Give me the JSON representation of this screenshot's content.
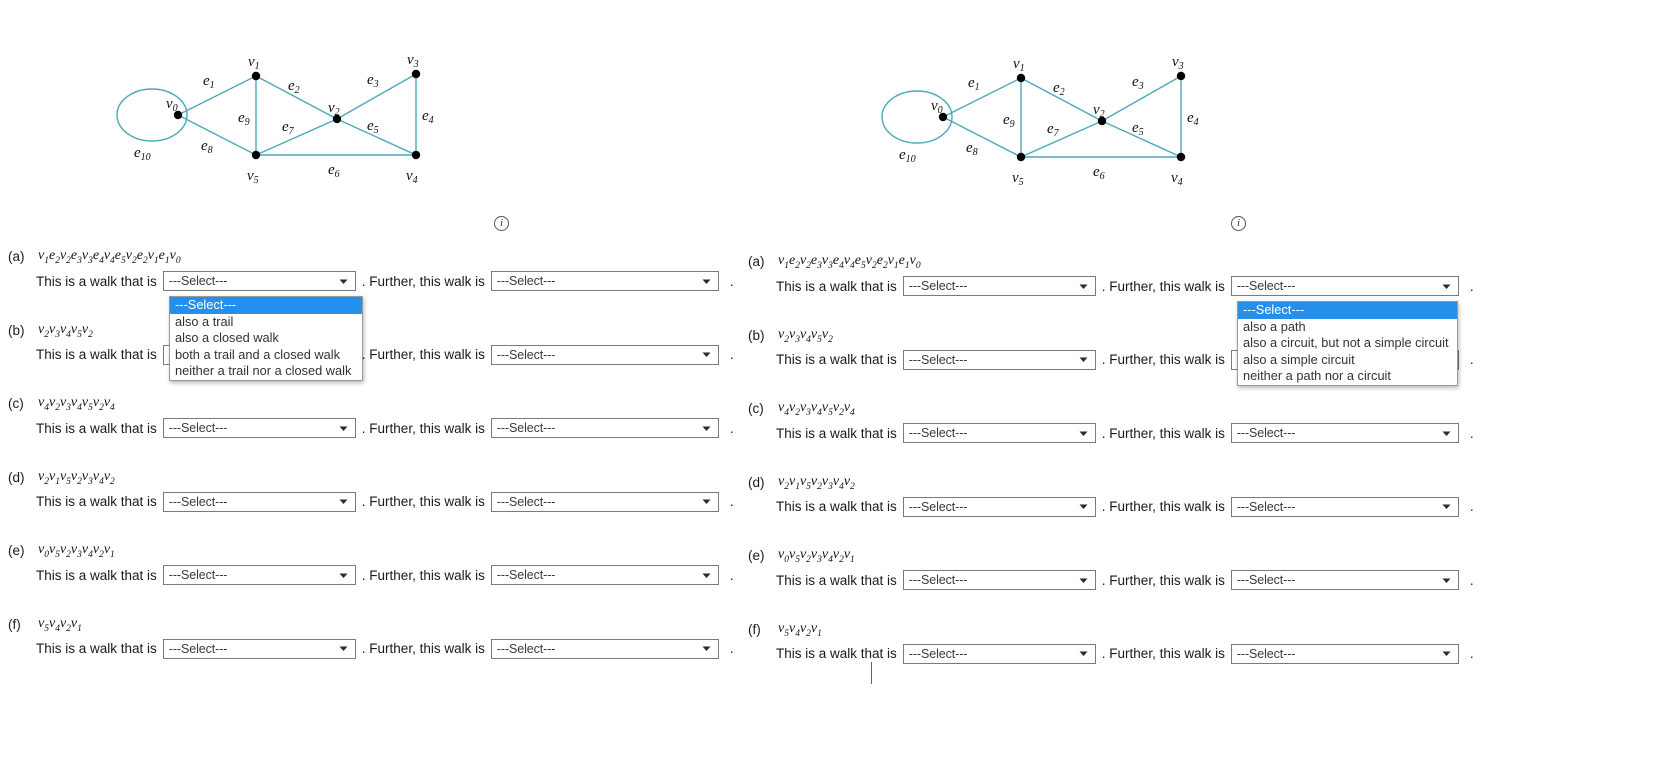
{
  "graph": {
    "caption_icon": "info-icon",
    "vertices": [
      {
        "id": "v0",
        "label": "v",
        "sub": "0"
      },
      {
        "id": "v1",
        "label": "v",
        "sub": "1"
      },
      {
        "id": "v2",
        "label": "v",
        "sub": "2"
      },
      {
        "id": "v3",
        "label": "v",
        "sub": "3"
      },
      {
        "id": "v4",
        "label": "v",
        "sub": "4"
      },
      {
        "id": "v5",
        "label": "v",
        "sub": "5"
      }
    ],
    "edges": [
      {
        "id": "e1",
        "label": "e",
        "sub": "1",
        "from": "v0",
        "to": "v1"
      },
      {
        "id": "e2",
        "label": "e",
        "sub": "2",
        "from": "v1",
        "to": "v2"
      },
      {
        "id": "e3",
        "label": "e",
        "sub": "3",
        "from": "v2",
        "to": "v3"
      },
      {
        "id": "e4",
        "label": "e",
        "sub": "4",
        "from": "v3",
        "to": "v4"
      },
      {
        "id": "e5",
        "label": "e",
        "sub": "5",
        "from": "v2",
        "to": "v4"
      },
      {
        "id": "e6",
        "label": "e",
        "sub": "6",
        "from": "v5",
        "to": "v4"
      },
      {
        "id": "e7",
        "label": "e",
        "sub": "7",
        "from": "v5",
        "to": "v2"
      },
      {
        "id": "e8",
        "label": "e",
        "sub": "8",
        "from": "v0",
        "to": "v5"
      },
      {
        "id": "e9",
        "label": "e",
        "sub": "9",
        "from": "v1",
        "to": "v5"
      },
      {
        "id": "e10",
        "label": "e",
        "sub": "10",
        "from": "v0",
        "to": "v0"
      }
    ],
    "edge_color": "#4aa9ba",
    "vertex_color": "#000000"
  },
  "questions": [
    {
      "key": "a",
      "label": "(a)",
      "walk": "v1e2v2e3v3e4v4e5v2e2v1e1v0",
      "walk_tokens": [
        [
          "v",
          "1"
        ],
        [
          "e",
          "2"
        ],
        [
          "v",
          "2"
        ],
        [
          "e",
          "3"
        ],
        [
          "v",
          "3"
        ],
        [
          "e",
          "4"
        ],
        [
          "v",
          "4"
        ],
        [
          "e",
          "5"
        ],
        [
          "v",
          "2"
        ],
        [
          "e",
          "2"
        ],
        [
          "v",
          "1"
        ],
        [
          "e",
          "1"
        ],
        [
          "v",
          "0"
        ]
      ],
      "sentence_prefix": "This is a walk that is",
      "sentence_middle": ". Further, this walk is",
      "sentence_suffix": "."
    },
    {
      "key": "b",
      "label": "(b)",
      "walk": "v2v3v4v5v2",
      "walk_tokens": [
        [
          "v",
          "2"
        ],
        [
          "v",
          "3"
        ],
        [
          "v",
          "4"
        ],
        [
          "v",
          "5"
        ],
        [
          "v",
          "2"
        ]
      ],
      "sentence_prefix": "This is a walk that is",
      "sentence_middle": ". Further, this walk is",
      "sentence_suffix": "."
    },
    {
      "key": "c",
      "label": "(c)",
      "walk": "v4v2v3v4v5v2v4",
      "walk_tokens": [
        [
          "v",
          "4"
        ],
        [
          "v",
          "2"
        ],
        [
          "v",
          "3"
        ],
        [
          "v",
          "4"
        ],
        [
          "v",
          "5"
        ],
        [
          "v",
          "2"
        ],
        [
          "v",
          "4"
        ]
      ],
      "sentence_prefix": "This is a walk that is",
      "sentence_middle": ". Further, this walk is",
      "sentence_suffix": "."
    },
    {
      "key": "d",
      "label": "(d)",
      "walk": "v2v1v5v2v3v4v2",
      "walk_tokens": [
        [
          "v",
          "2"
        ],
        [
          "v",
          "1"
        ],
        [
          "v",
          "5"
        ],
        [
          "v",
          "2"
        ],
        [
          "v",
          "3"
        ],
        [
          "v",
          "4"
        ],
        [
          "v",
          "2"
        ]
      ],
      "sentence_prefix": "This is a walk that is",
      "sentence_middle": ". Further, this walk is",
      "sentence_suffix": "."
    },
    {
      "key": "e",
      "label": "(e)",
      "walk": "v0v5v2v3v4v2v1",
      "walk_tokens": [
        [
          "v",
          "0"
        ],
        [
          "v",
          "5"
        ],
        [
          "v",
          "2"
        ],
        [
          "v",
          "3"
        ],
        [
          "v",
          "4"
        ],
        [
          "v",
          "2"
        ],
        [
          "v",
          "1"
        ]
      ],
      "sentence_prefix": "This is a walk that is",
      "sentence_middle": ". Further, this walk is",
      "sentence_suffix": "."
    },
    {
      "key": "f",
      "label": "(f)",
      "walk": "v5v4v2v1",
      "walk_tokens": [
        [
          "v",
          "5"
        ],
        [
          "v",
          "4"
        ],
        [
          "v",
          "2"
        ],
        [
          "v",
          "1"
        ]
      ],
      "sentence_prefix": "This is a walk that is",
      "sentence_middle": ". Further, this walk is",
      "sentence_suffix": "."
    }
  ],
  "select": {
    "placeholder": "---Select---",
    "value": "---Select---",
    "arrow_icon": "chevron-down-icon"
  },
  "dropdown_left": {
    "open": true,
    "highlighted": "---Select---",
    "options": [
      "---Select---",
      "also a trail",
      "also a closed walk",
      "both a trail and a closed walk",
      "neither a trail nor a closed walk"
    ]
  },
  "dropdown_right": {
    "open": true,
    "highlighted": "---Select---",
    "options": [
      "---Select---",
      "also a path",
      "also a circuit, but not a simple circuit",
      "also a simple circuit",
      "neither a path nor a circuit"
    ]
  },
  "colors": {
    "highlight": "#2490eb",
    "edge": "#4aa9ba",
    "border": "#7a7a7a",
    "text": "#1a1a1a"
  }
}
